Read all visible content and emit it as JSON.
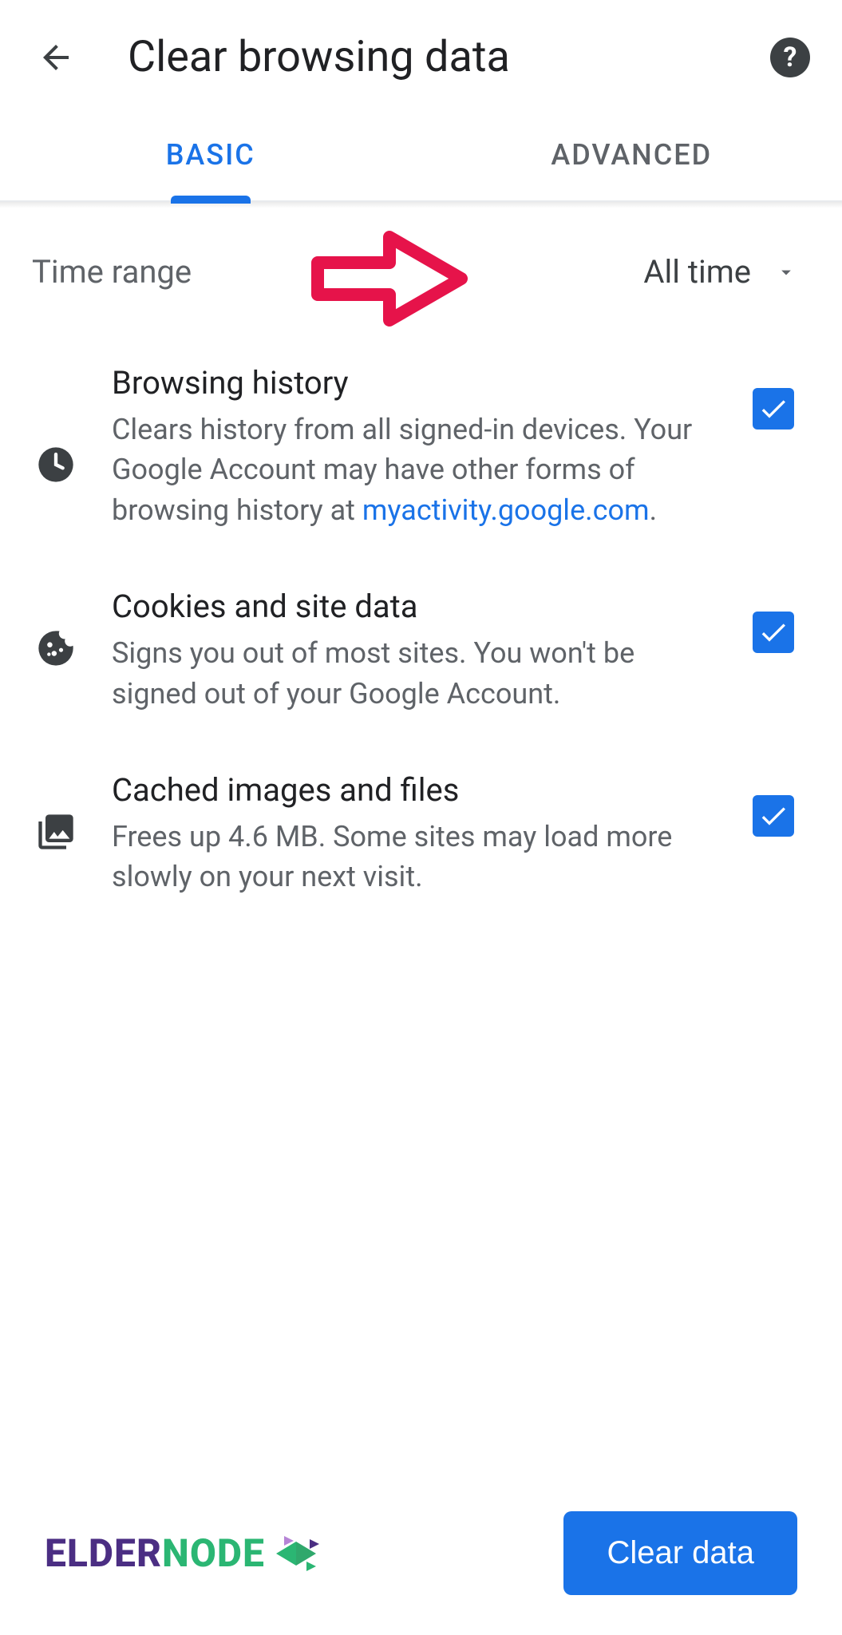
{
  "header": {
    "title": "Clear browsing data"
  },
  "tabs": {
    "basic": "BASIC",
    "advanced": "ADVANCED"
  },
  "time_range": {
    "label": "Time range",
    "value": "All time"
  },
  "items": [
    {
      "title": "Browsing history",
      "desc_prefix": "Clears history from all signed-in devices. Your Google Account may have other forms of browsing history at ",
      "link_text": "myactivity.google.com",
      "desc_suffix": ".",
      "checked": true
    },
    {
      "title": "Cookies and site data",
      "desc": "Signs you out of most sites. You won't be signed out of your Google Account.",
      "checked": true
    },
    {
      "title": "Cached images and files",
      "desc": "Frees up 4.6 MB. Some sites may load more slowly on your next visit.",
      "checked": true
    }
  ],
  "footer": {
    "logo_part1": "ELDER",
    "logo_part2": "NODE",
    "button": "Clear data"
  }
}
